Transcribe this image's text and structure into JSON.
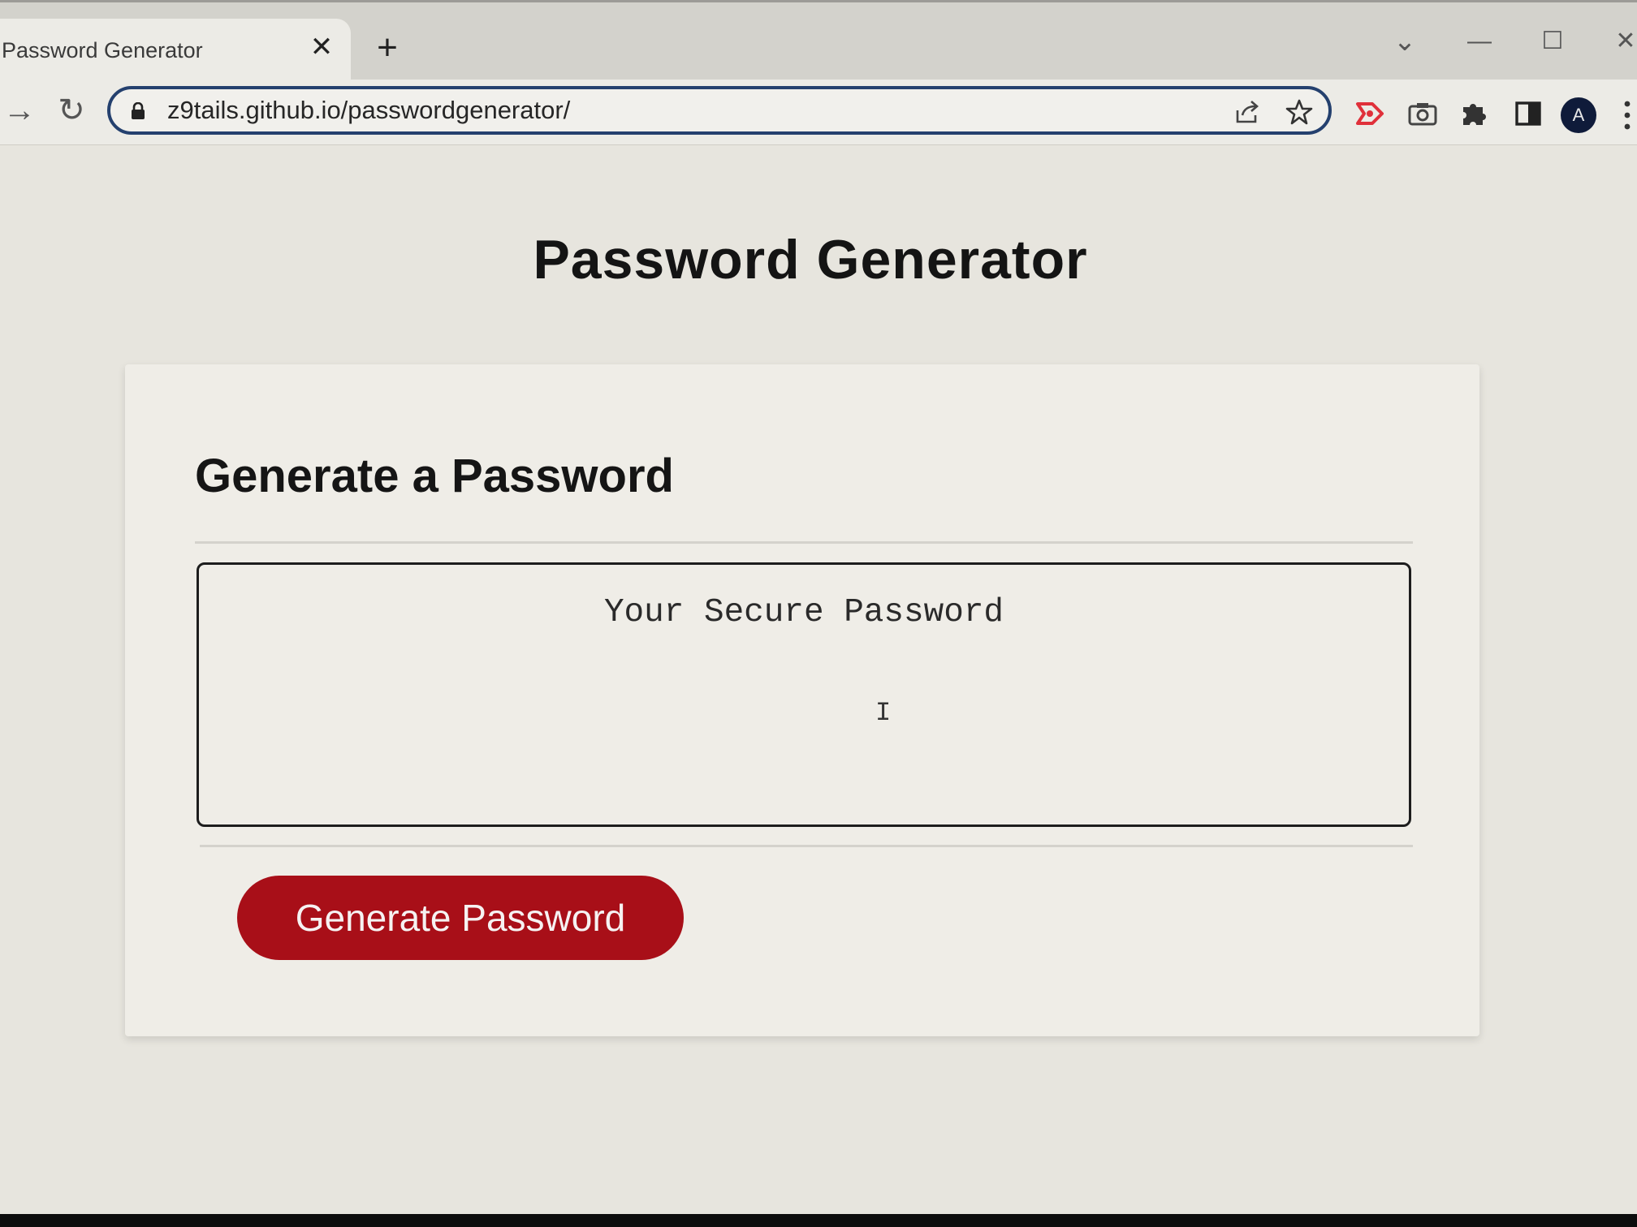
{
  "browser": {
    "tab": {
      "title": "Password Generator",
      "close_glyph": "✕"
    },
    "new_tab_glyph": "+",
    "window_controls": {
      "chevron_glyph": "⌄",
      "minimize_glyph": "—",
      "maximize_glyph": "☐",
      "close_glyph": "✕"
    },
    "nav": {
      "forward_glyph": "→",
      "reload_glyph": "↻"
    },
    "address_bar": {
      "url": "z9tails.github.io/passwordgenerator/"
    },
    "icons": {
      "lock": "lock-icon",
      "share": "share-icon",
      "bookmark": "star-icon",
      "extension_red": "red-extension-icon",
      "camera": "camera-icon",
      "extensions": "puzzle-icon",
      "side_panel": "side-panel-icon",
      "profile": "profile-avatar",
      "menu": "kebab-menu-icon"
    },
    "avatar_glyph": "A"
  },
  "page": {
    "title": "Password Generator",
    "card": {
      "header": "Generate a Password",
      "password_field": {
        "placeholder": "Your Secure Password",
        "value": ""
      },
      "generate_button_label": "Generate Password"
    },
    "text_cursor_glyph": "I"
  },
  "colors": {
    "button_bg": "#a80f18",
    "button_text": "#f6f2f2",
    "page_bg": "#e7e5de",
    "card_bg": "#efede7",
    "omnibox_border": "#24406e"
  }
}
